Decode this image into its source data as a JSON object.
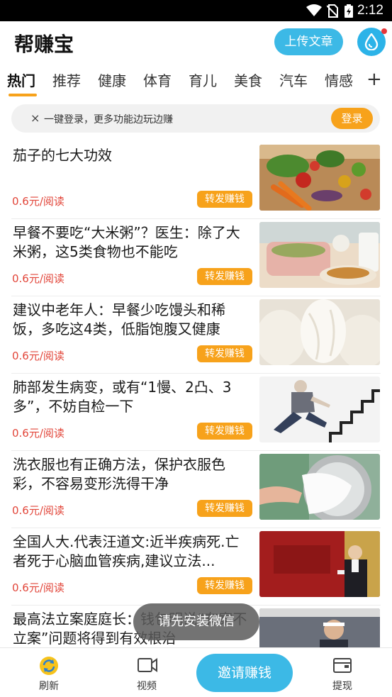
{
  "status_bar": {
    "time": "2:12",
    "icons": [
      "wifi-icon",
      "no-sim-icon",
      "battery-charging-icon"
    ]
  },
  "header": {
    "title": "帮赚宝",
    "upload_label": "上传文章",
    "drop_icon": "water-drop-icon"
  },
  "tabs": [
    "热门",
    "推荐",
    "健康",
    "体育",
    "育儿",
    "美食",
    "汽车",
    "情感"
  ],
  "tabs_more": "+",
  "login_banner": {
    "close": "×",
    "message": "一键登录，更多功能边玩边赚",
    "button": "登录"
  },
  "articles": [
    {
      "title": "茄子的七大功效",
      "price": "0.6元/阅读",
      "share": "转发赚钱"
    },
    {
      "title": "早餐不要吃“大米粥”？医生：除了大米粥，这5类食物也不能吃",
      "price": "0.6元/阅读",
      "share": "转发赚钱"
    },
    {
      "title": "建议中老年人：早餐少吃馒头和稀饭，多吃这4类，低脂饱腹又健康",
      "price": "0.6元/阅读",
      "share": "转发赚钱"
    },
    {
      "title": "肺部发生病变，或有“1慢、2凸、3多”，不妨自检一下",
      "price": "0.6元/阅读",
      "share": "转发赚钱"
    },
    {
      "title": "洗衣服也有正确方法，保护衣服色彩，不容易变形洗得干净",
      "price": "0.6元/阅读",
      "share": "转发赚钱"
    },
    {
      "title": "全国人大.代表汪道文:近半疾病死.亡者死于心脑血管疾病,建议立法...",
      "price": "0.6元/阅读",
      "share": "转发赚钱"
    },
    {
      "title": "最高法立案庭庭长：钱包明说“有案不立案”问题将得到有效根治",
      "price": "",
      "share": ""
    }
  ],
  "toast": "请先安装微信",
  "bottom_nav": {
    "refresh": "刷新",
    "video": "视频",
    "invite": "邀请赚钱",
    "withdraw": "提现"
  },
  "colors": {
    "accent_blue": "#3cb9e6",
    "accent_orange": "#f7a21b",
    "price_red": "#e2463a"
  }
}
